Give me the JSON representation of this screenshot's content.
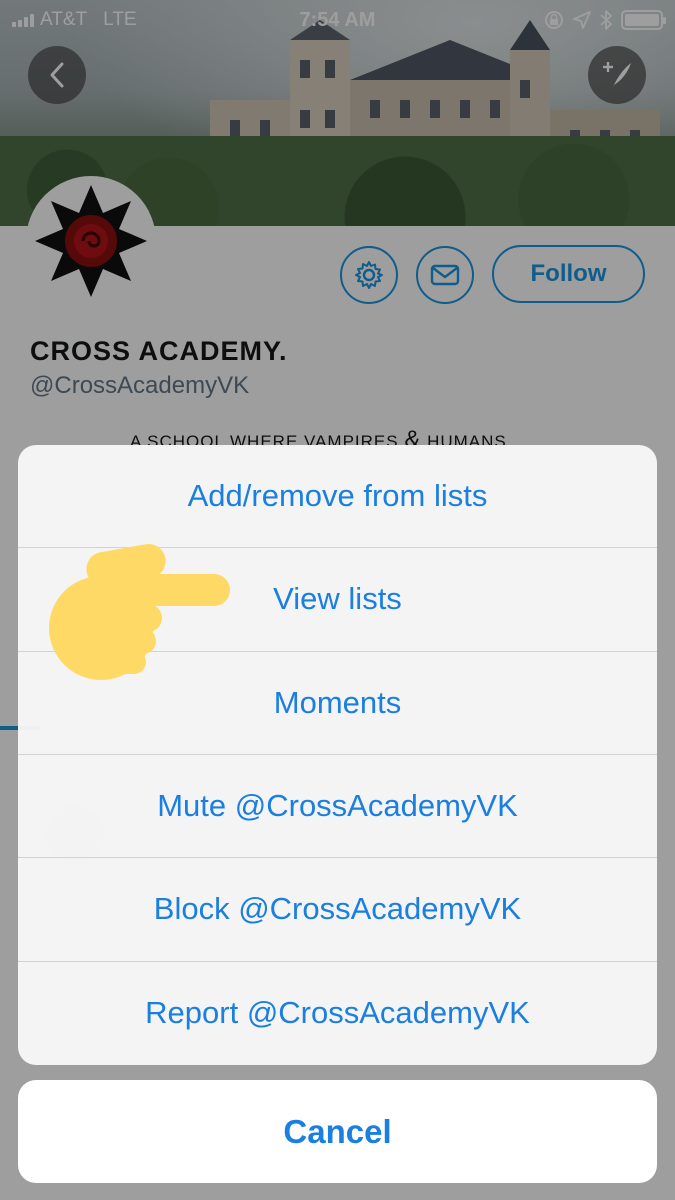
{
  "status_bar": {
    "carrier": "AT&T",
    "network": "LTE",
    "time": "7:54 AM",
    "icons": [
      "signal-bars-icon",
      "orientation-lock-icon",
      "location-arrow-icon",
      "bluetooth-icon",
      "battery-icon"
    ]
  },
  "header": {
    "back_icon": "chevron-left-icon",
    "compose_icon": "compose-tweet-icon"
  },
  "profile": {
    "name": "CROSS ACADEMY.",
    "handle": "@CrossAcademyVK",
    "bio_part1": "A SCHOOL WHERE VAMPIRES",
    "bio_amp": "&",
    "bio_part2": "HUMANS",
    "follow_label": "Follow",
    "settings_icon": "gear-icon",
    "message_icon": "mail-icon"
  },
  "action_sheet": {
    "items": [
      {
        "label": "Add/remove from lists"
      },
      {
        "label": "View lists"
      },
      {
        "label": "Moments"
      },
      {
        "label": "Mute @CrossAcademyVK"
      },
      {
        "label": "Block @CrossAcademyVK"
      },
      {
        "label": "Report @CrossAcademyVK"
      }
    ],
    "cancel_label": "Cancel"
  },
  "overlay": {
    "pointer_icon": "pointing-hand-emoji-icon",
    "pointer_color": "#FFD966"
  },
  "colors": {
    "accent": "#1B95E0",
    "sheet_text": "#1A7FE0"
  }
}
